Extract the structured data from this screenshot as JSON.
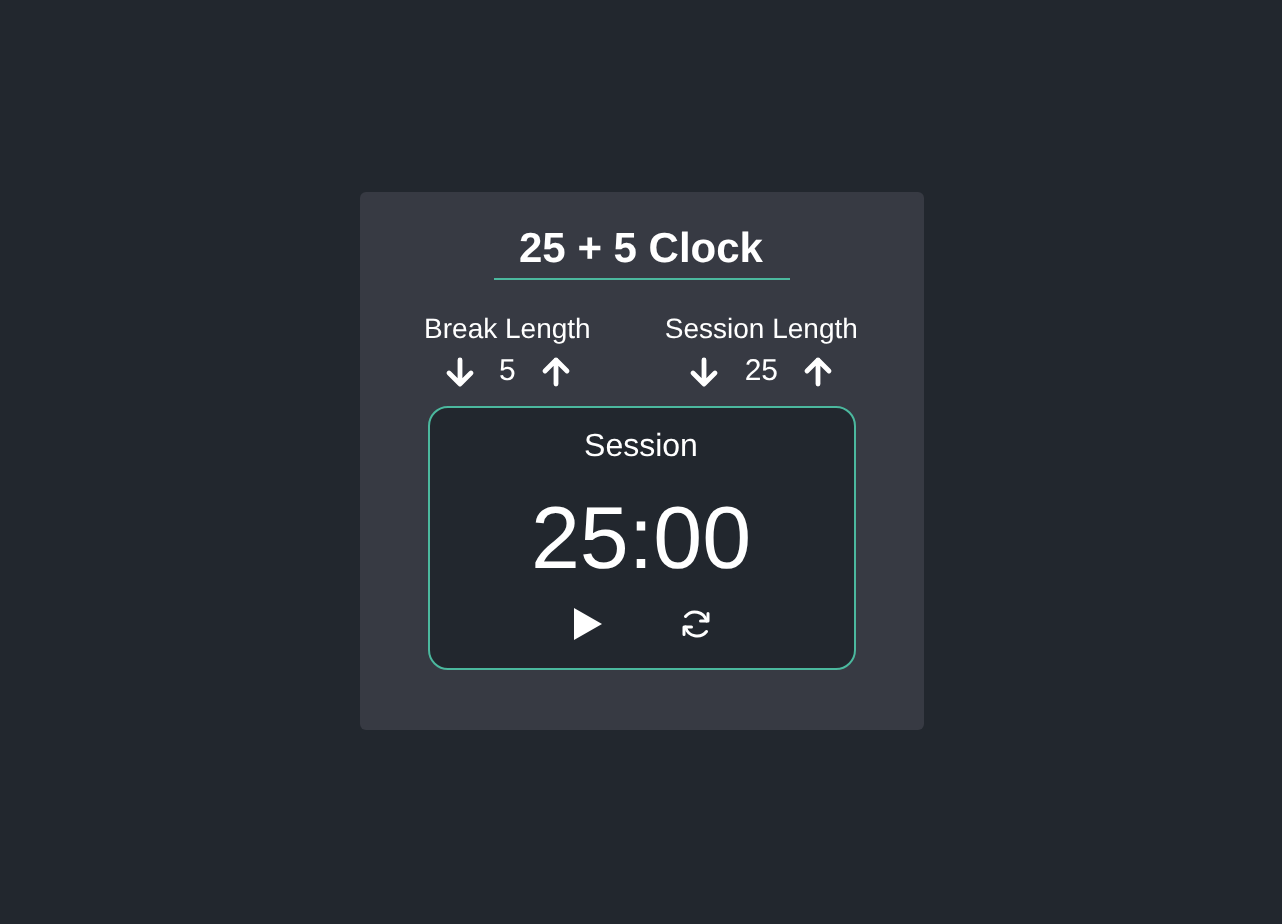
{
  "title": "25 + 5 Clock",
  "controls": [
    {
      "label": "Break Length",
      "value": "5"
    },
    {
      "label": "Session Length",
      "value": "25"
    }
  ],
  "timer": {
    "label": "Session",
    "time": "25:00",
    "running": false
  }
}
